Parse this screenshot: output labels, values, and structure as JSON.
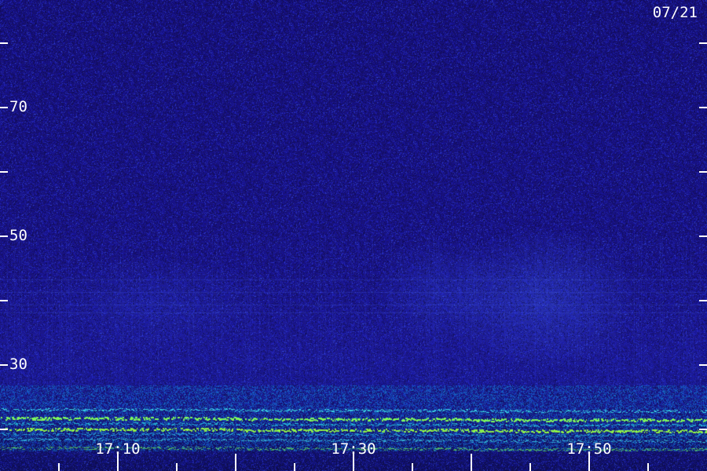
{
  "date_label": "07/21",
  "y_axis": {
    "labels": [
      "70",
      "50",
      "30"
    ]
  },
  "x_axis": {
    "labels": [
      "17:10",
      "17:30",
      "17:50"
    ]
  },
  "colors": {
    "background": "#15106b",
    "noise": "#2a22c8",
    "band_cyan": "#1ec8d8",
    "band_green": "#7dff40",
    "text": "#ffffff"
  }
}
